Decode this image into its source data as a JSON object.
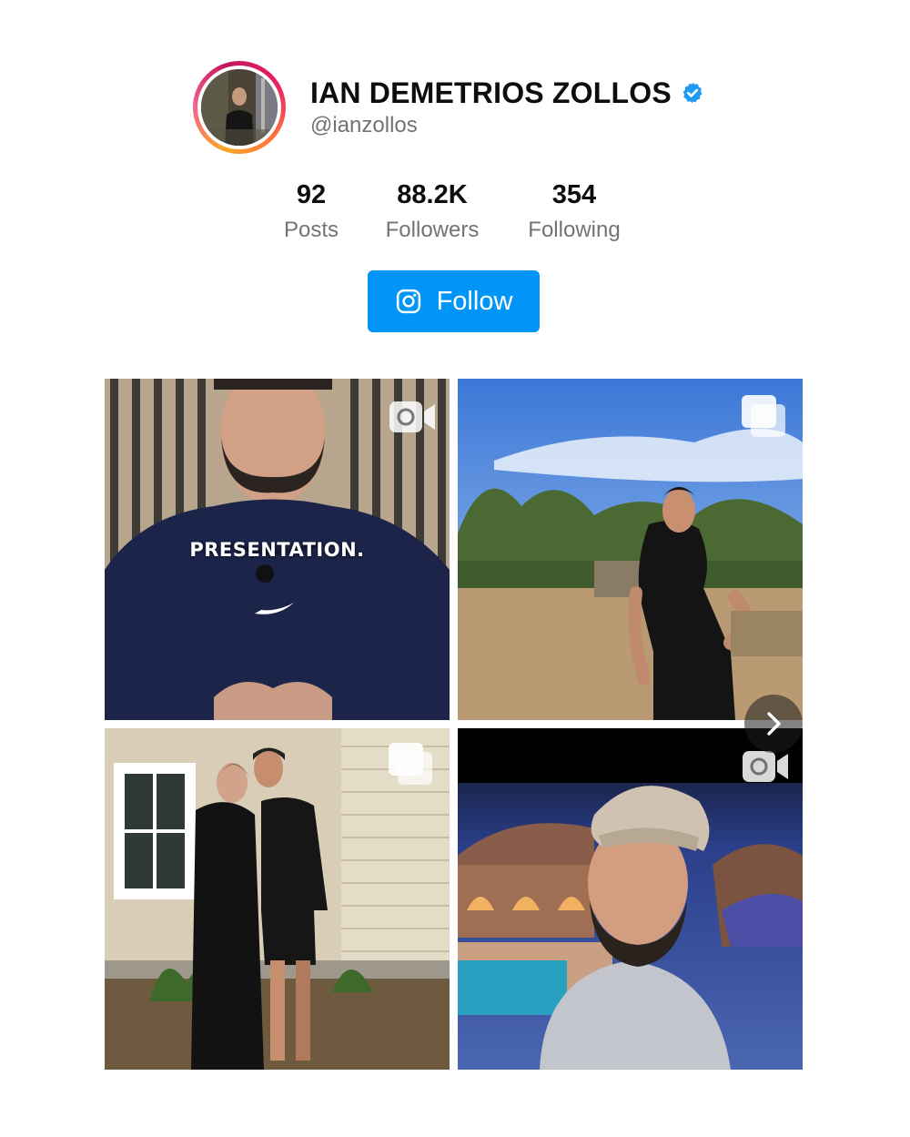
{
  "profile": {
    "display_name": "IAN DEMETRIOS ZOLLOS",
    "handle": "@ianzollos",
    "verified": true
  },
  "stats": [
    {
      "value": "92",
      "label": "Posts"
    },
    {
      "value": "88.2K",
      "label": "Followers"
    },
    {
      "value": "354",
      "label": "Following"
    }
  ],
  "follow_button": {
    "label": "Follow",
    "icon": "instagram-icon",
    "color": "#0095f6"
  },
  "posts": [
    {
      "type": "video",
      "icon": "video-camera-icon",
      "caption": "PRESENTATION."
    },
    {
      "type": "carousel",
      "icon": "carousel-icon"
    },
    {
      "type": "carousel",
      "icon": "carousel-icon"
    },
    {
      "type": "video",
      "icon": "video-camera-icon"
    }
  ],
  "carousel_next": {
    "icon": "chevron-right-icon"
  },
  "colors": {
    "accent": "#0095f6",
    "verified": "#1d9bf0",
    "muted_text": "#737373"
  }
}
